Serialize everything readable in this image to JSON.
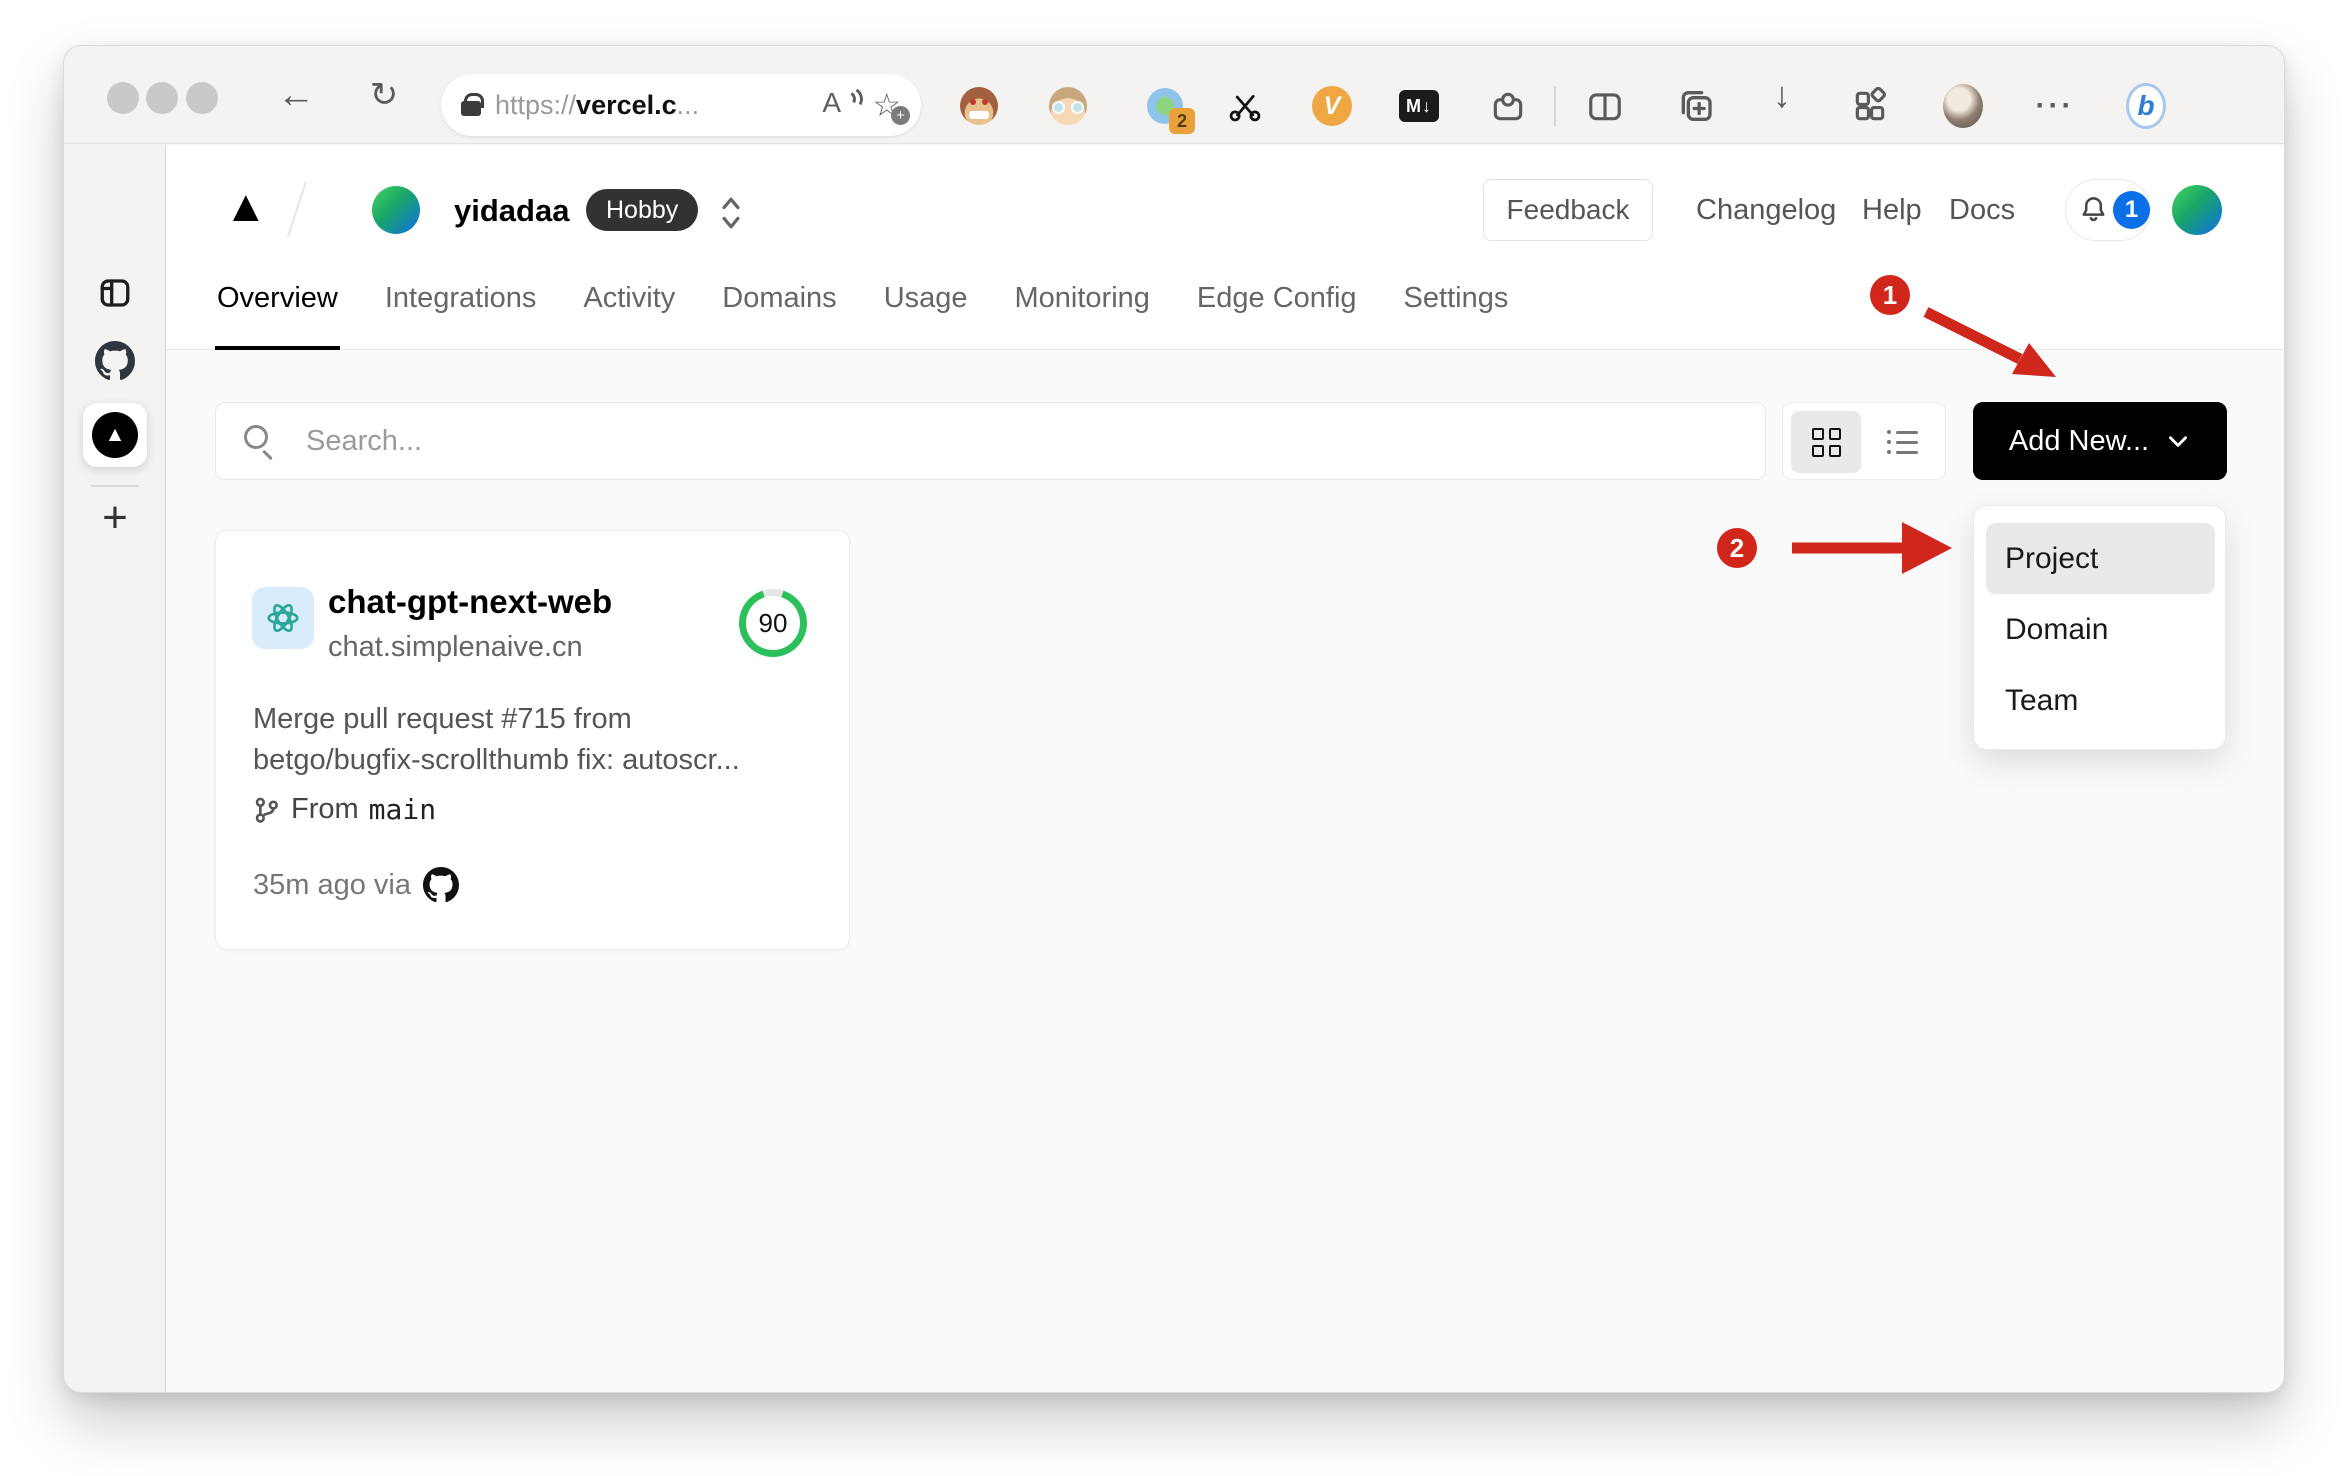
{
  "browser": {
    "back_icon": "←",
    "refresh_icon": "↻",
    "address": {
      "prefix": "https://",
      "host": "vercel.c",
      "ellipsis": "...",
      "reader_icon": "A",
      "star_icon": "☆",
      "star_plus": "+"
    },
    "extensions": {
      "badge_count": "2",
      "v_label": "V",
      "md_label": "M↓"
    },
    "download_icon": "↓",
    "more_icon": "···",
    "bing_label": "b"
  },
  "edge_sidebar": {
    "vercel_glyph": "▲",
    "add_icon": "+"
  },
  "header": {
    "logo_glyph": "▲",
    "team_name": "yidadaa",
    "plan_badge": "Hobby",
    "feedback_label": "Feedback",
    "links": [
      "Changelog",
      "Help",
      "Docs"
    ],
    "notification_count": "1"
  },
  "tabs": [
    {
      "label": "Overview",
      "active": true
    },
    {
      "label": "Integrations"
    },
    {
      "label": "Activity"
    },
    {
      "label": "Domains"
    },
    {
      "label": "Usage"
    },
    {
      "label": "Monitoring"
    },
    {
      "label": "Edge Config"
    },
    {
      "label": "Settings"
    }
  ],
  "toolbar": {
    "search_placeholder": "Search...",
    "add_new_label": "Add New..."
  },
  "dropdown": {
    "items": [
      {
        "label": "Project",
        "highlighted": true
      },
      {
        "label": "Domain"
      },
      {
        "label": "Team"
      }
    ]
  },
  "card": {
    "name": "chat-gpt-next-web",
    "domain": "chat.simplenaive.cn",
    "score": "90",
    "commit_message": "Merge pull request #715 from betgo/bugfix-scrollthumb fix: autoscr...",
    "branch_label": "From",
    "branch_name": "main",
    "time_ago": "35m ago via"
  },
  "annotations": {
    "step1": "1",
    "step2": "2",
    "color": "#d0261b"
  },
  "colors": {
    "gauge_green": "#2bc05c",
    "notification_blue": "#0b6fe8",
    "hobby_badge_bg": "#323232",
    "add_new_bg": "#000000",
    "avatar_gradient": [
      "#3ecf5f",
      "#1173e0"
    ]
  }
}
